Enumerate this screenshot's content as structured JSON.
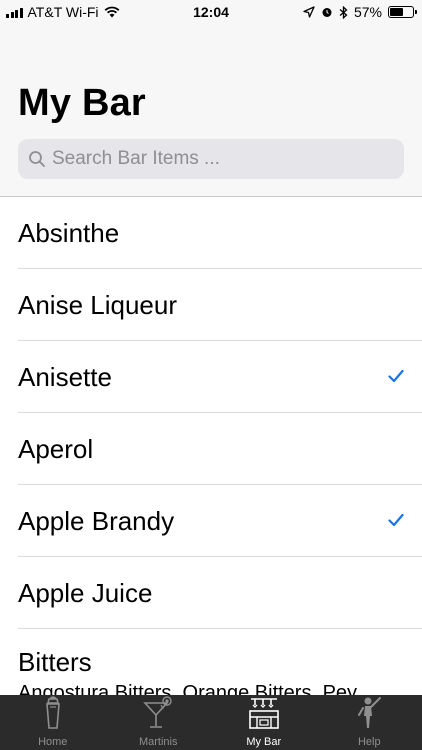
{
  "status_bar": {
    "carrier": "AT&T Wi-Fi",
    "time": "12:04",
    "battery": "57%",
    "battery_level": 0.57
  },
  "header": {
    "title": "My Bar"
  },
  "search": {
    "placeholder": "Search Bar Items ..."
  },
  "items": [
    {
      "name": "Absinthe",
      "checked": false
    },
    {
      "name": "Anise Liqueur",
      "checked": false
    },
    {
      "name": "Anisette",
      "checked": true
    },
    {
      "name": "Aperol",
      "checked": false
    },
    {
      "name": "Apple Brandy",
      "checked": true
    },
    {
      "name": "Apple Juice",
      "checked": false
    },
    {
      "name": "Bitters",
      "subtitle": "Angostura Bitters, Orange Bitters, Pey",
      "checked": false
    }
  ],
  "tabs": [
    {
      "label": "Home",
      "icon": "shaker-icon",
      "active": false
    },
    {
      "label": "Martinis",
      "icon": "martini-glass-icon",
      "active": false
    },
    {
      "label": "My Bar",
      "icon": "bar-icon",
      "active": true
    },
    {
      "label": "Help",
      "icon": "bartender-icon",
      "active": false
    }
  ],
  "colors": {
    "accent": "#1a73e8",
    "tab_bar": "#2b2b2b",
    "header_bg": "#f7f7f7"
  }
}
